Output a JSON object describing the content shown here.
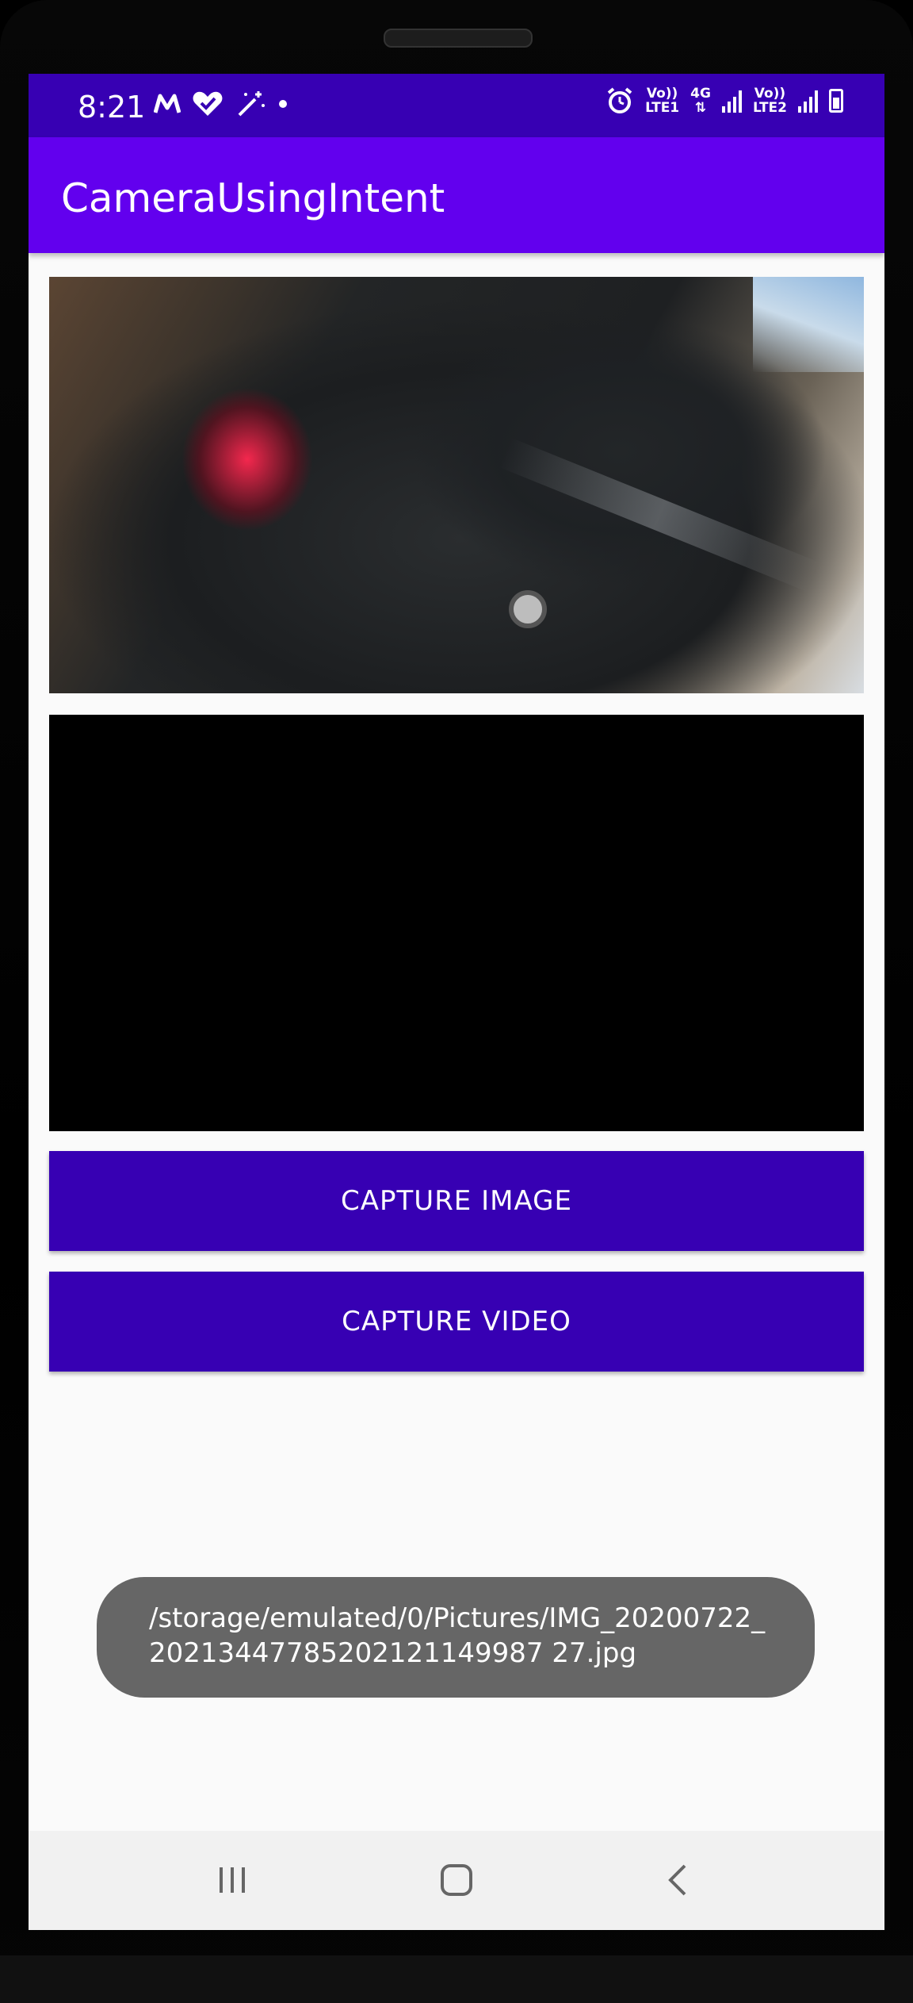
{
  "status_bar": {
    "time": "8:21",
    "left_icons": [
      "m-logo-icon",
      "heart-check-icon",
      "magic-wand-icon",
      "dot-icon"
    ],
    "network_1_top": "Vo))",
    "network_1_bottom": "LTE1",
    "network_type": "4G",
    "network_2_top": "Vo))",
    "network_2_bottom": "LTE2"
  },
  "app_bar": {
    "title": "CameraUsingIntent"
  },
  "buttons": {
    "capture_image": "CAPTURE IMAGE",
    "capture_video": "CAPTURE VIDEO"
  },
  "toast": {
    "message": "/storage/emulated/0/Pictures/IMG_20200722_20213447785202121149987 27.jpg"
  },
  "nav_bar": {
    "icons": [
      "recent-apps-icon",
      "home-icon",
      "back-icon"
    ]
  },
  "colors": {
    "status_bar": "#3700b3",
    "app_bar": "#6200ee",
    "button": "#3700b3",
    "toast": "#666666"
  }
}
